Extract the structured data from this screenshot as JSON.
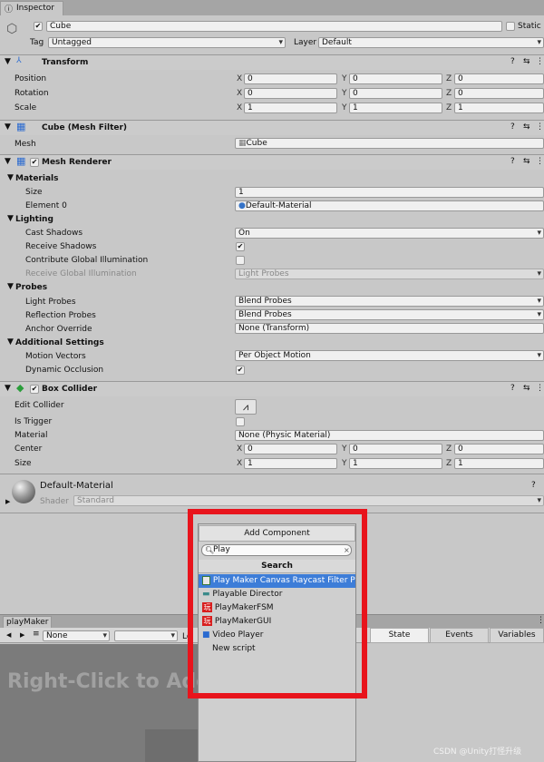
{
  "tab": {
    "title": "Inspector"
  },
  "object": {
    "name": "Cube",
    "static_label": "Static",
    "tag_label": "Tag",
    "tag_value": "Untagged",
    "layer_label": "Layer",
    "layer_value": "Default"
  },
  "transform": {
    "title": "Transform",
    "rows": [
      {
        "label": "Position",
        "x": "0",
        "y": "0",
        "z": "0"
      },
      {
        "label": "Rotation",
        "x": "0",
        "y": "0",
        "z": "0"
      },
      {
        "label": "Scale",
        "x": "1",
        "y": "1",
        "z": "1"
      }
    ],
    "axis": {
      "x": "X",
      "y": "Y",
      "z": "Z"
    }
  },
  "mesh_filter": {
    "title": "Cube (Mesh Filter)",
    "mesh_label": "Mesh",
    "mesh_value": "Cube"
  },
  "mesh_renderer": {
    "title": "Mesh Renderer",
    "materials": "Materials",
    "size_label": "Size",
    "size_value": "1",
    "element0_label": "Element 0",
    "element0_value": "Default-Material",
    "lighting": "Lighting",
    "cast_shadows_label": "Cast Shadows",
    "cast_shadows_value": "On",
    "receive_shadows_label": "Receive Shadows",
    "contribute_gi_label": "Contribute Global Illumination",
    "receive_gi_label": "Receive Global Illumination",
    "receive_gi_value": "Light Probes",
    "probes": "Probes",
    "light_probes_label": "Light Probes",
    "light_probes_value": "Blend Probes",
    "reflection_probes_label": "Reflection Probes",
    "reflection_probes_value": "Blend Probes",
    "anchor_label": "Anchor Override",
    "anchor_value": "None (Transform)",
    "additional": "Additional Settings",
    "motion_label": "Motion Vectors",
    "motion_value": "Per Object Motion",
    "dynamic_occlusion_label": "Dynamic Occlusion"
  },
  "box_collider": {
    "title": "Box Collider",
    "edit_label": "Edit Collider",
    "trigger_label": "Is Trigger",
    "material_label": "Material",
    "material_value": "None (Physic Material)",
    "center_label": "Center",
    "center": {
      "x": "0",
      "y": "0",
      "z": "0"
    },
    "size_label": "Size",
    "size": {
      "x": "1",
      "y": "1",
      "z": "1"
    }
  },
  "material": {
    "name": "Default-Material",
    "shader_label": "Shader",
    "shader_value": "Standard"
  },
  "add_component": {
    "button": "Add Component",
    "search_value": "Play",
    "heading": "Search",
    "items": [
      {
        "label": "Play Maker Canvas Raycast Filter Pro",
        "icon": "script-icon"
      },
      {
        "label": "Playable Director",
        "icon": "director-icon"
      },
      {
        "label": "PlayMakerFSM",
        "icon": "playmaker-icon"
      },
      {
        "label": "PlayMakerGUI",
        "icon": "playmaker-icon"
      },
      {
        "label": "Video Player",
        "icon": "video-icon"
      },
      {
        "label": "New script",
        "icon": ""
      }
    ]
  },
  "playmaker": {
    "tab": "playMaker",
    "none_left": "None",
    "lock_partial": "Lo",
    "tabs": [
      "State",
      "Events",
      "Variables"
    ],
    "hint": "Right-Click to Add"
  },
  "watermark": "CSDN @Unity打怪升级",
  "colors": {
    "highlight": "#3d7dd8",
    "callout": "#e8141c"
  }
}
